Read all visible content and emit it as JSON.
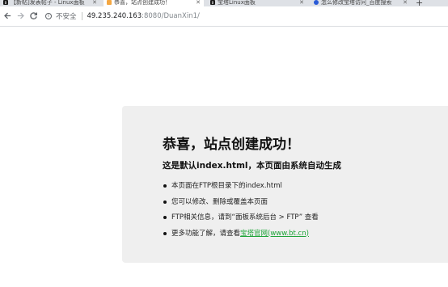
{
  "tabs": [
    {
      "title": "【新帖]发表帖子 - Linux面板",
      "favicon": "B",
      "favicon_color": "#1a1a1a",
      "active": false
    },
    {
      "title": "恭喜，站点创建成功！",
      "favicon": "",
      "favicon_color": "#f4a742",
      "active": true
    },
    {
      "title": "宝塔Linux面板",
      "favicon": "B",
      "favicon_color": "#1a1a1a",
      "active": false
    },
    {
      "title": "怎么修改宝塔访问_百度搜索",
      "favicon": "",
      "favicon_color": "#2a5bd7",
      "active": false
    }
  ],
  "toolbar": {
    "security_label": "不安全",
    "url_host": "49.235.240.163",
    "url_rest": ":8080/DuanXin1/"
  },
  "page": {
    "title": "恭喜，站点创建成功！",
    "subtitle": "这是默认index.html，本页面由系统自动生成",
    "items": [
      "本页面在FTP根目录下的index.html",
      "您可以修改、删除或覆盖本页面",
      "FTP相关信息，请到“面板系统后台 > FTP” 查看"
    ],
    "last_item_prefix": "更多功能了解，请查看",
    "last_item_link": "宝塔官网(www.bt.cn)"
  }
}
